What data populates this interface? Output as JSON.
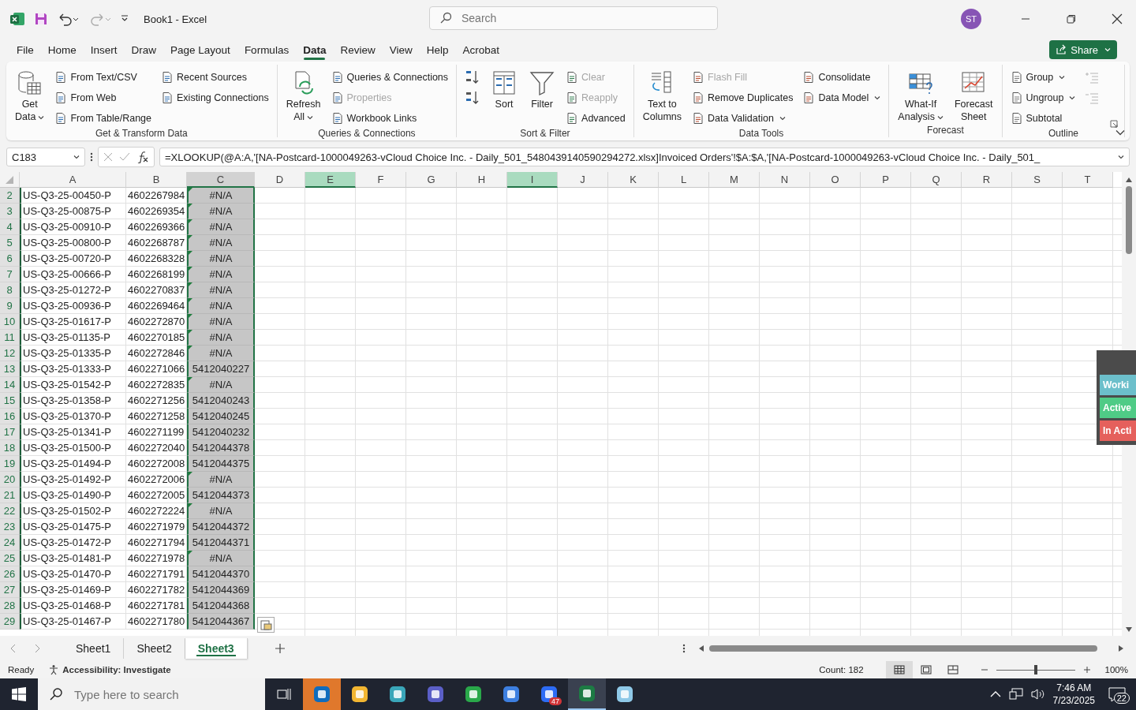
{
  "title_bar": {
    "title": "Book1  -  Excel",
    "search_placeholder": "Search",
    "avatar": "ST"
  },
  "menu_tabs": [
    {
      "label": "File",
      "selected": false
    },
    {
      "label": "Home",
      "selected": false
    },
    {
      "label": "Insert",
      "selected": false
    },
    {
      "label": "Draw",
      "selected": false
    },
    {
      "label": "Page Layout",
      "selected": false
    },
    {
      "label": "Formulas",
      "selected": false
    },
    {
      "label": "Data",
      "selected": true
    },
    {
      "label": "Review",
      "selected": false
    },
    {
      "label": "View",
      "selected": false
    },
    {
      "label": "Help",
      "selected": false
    },
    {
      "label": "Acrobat",
      "selected": false
    }
  ],
  "share_button": "Share",
  "ribbon_groups": [
    {
      "label": "Get & Transform Data",
      "items": [
        {
          "label": "Get\nData",
          "kind": "large",
          "dropdown": true,
          "disabled": false
        },
        {
          "label": "From Text/CSV",
          "kind": "small",
          "dropdown": false,
          "disabled": false
        },
        {
          "label": "From Web",
          "kind": "small",
          "dropdown": false,
          "disabled": false
        },
        {
          "label": "From Table/Range",
          "kind": "small",
          "dropdown": false,
          "disabled": false
        },
        {
          "label": "Recent Sources",
          "kind": "small",
          "dropdown": false,
          "disabled": false
        },
        {
          "label": "Existing Connections",
          "kind": "small",
          "dropdown": false,
          "disabled": false
        }
      ]
    },
    {
      "label": "Queries & Connections",
      "items": [
        {
          "label": "Refresh\nAll",
          "kind": "large",
          "dropdown": true,
          "disabled": false
        },
        {
          "label": "Queries & Connections",
          "kind": "small",
          "dropdown": false,
          "disabled": false
        },
        {
          "label": "Properties",
          "kind": "small",
          "dropdown": false,
          "disabled": true
        },
        {
          "label": "Workbook Links",
          "kind": "small",
          "dropdown": false,
          "disabled": false
        }
      ]
    },
    {
      "label": "Sort & Filter",
      "items": [
        {
          "kind": "icon",
          "disabled": false
        },
        {
          "kind": "icon",
          "disabled": false
        },
        {
          "label": "Sort",
          "kind": "large",
          "dropdown": false,
          "disabled": false
        },
        {
          "label": "Filter",
          "kind": "large",
          "dropdown": false,
          "disabled": false
        },
        {
          "label": "Clear",
          "kind": "small",
          "dropdown": false,
          "disabled": true
        },
        {
          "label": "Reapply",
          "kind": "small",
          "dropdown": false,
          "disabled": true
        },
        {
          "label": "Advanced",
          "kind": "small",
          "dropdown": false,
          "disabled": false
        }
      ]
    },
    {
      "label": "Data Tools",
      "items": [
        {
          "label": "Text to\nColumns",
          "kind": "large",
          "dropdown": false,
          "disabled": false
        },
        {
          "label": "Flash Fill",
          "kind": "small",
          "dropdown": false,
          "disabled": true
        },
        {
          "label": "Remove Duplicates",
          "kind": "small",
          "dropdown": false,
          "disabled": false
        },
        {
          "label": "Data Validation",
          "kind": "small",
          "dropdown": true,
          "disabled": false
        },
        {
          "label": "Consolidate",
          "kind": "small",
          "dropdown": false,
          "disabled": false
        },
        {
          "label": "Data Model",
          "kind": "small",
          "dropdown": true,
          "disabled": false
        }
      ]
    },
    {
      "label": "Forecast",
      "items": [
        {
          "label": "What-If\nAnalysis",
          "kind": "large",
          "dropdown": true,
          "disabled": false
        },
        {
          "label": "Forecast\nSheet",
          "kind": "large",
          "dropdown": false,
          "disabled": false
        }
      ]
    },
    {
      "label": "Outline",
      "items": [
        {
          "label": "Group",
          "kind": "small",
          "dropdown": true,
          "disabled": false
        },
        {
          "label": "Ungroup",
          "kind": "small",
          "dropdown": true,
          "disabled": false
        },
        {
          "label": "Subtotal",
          "kind": "small",
          "dropdown": false,
          "disabled": false
        },
        {
          "kind": "icon",
          "disabled": true
        },
        {
          "kind": "icon",
          "disabled": true
        }
      ]
    }
  ],
  "formula_bar": {
    "name_box": "C183",
    "formula": "=XLOOKUP(@A:A,'[NA-Postcard-1000049263-vCloud Choice Inc. - Daily_501_5480439140590294272.xlsx]Invoiced Orders'!$A:$A,'[NA-Postcard-1000049263-vCloud Choice Inc. - Daily_501_"
  },
  "columns": [
    {
      "label": "A",
      "in_range": false,
      "selected": false
    },
    {
      "label": "B",
      "in_range": false,
      "selected": false
    },
    {
      "label": "C",
      "in_range": true,
      "selected": false
    },
    {
      "label": "D",
      "in_range": false,
      "selected": false
    },
    {
      "label": "E",
      "in_range": false,
      "selected": true
    },
    {
      "label": "F",
      "in_range": false,
      "selected": false
    },
    {
      "label": "G",
      "in_range": false,
      "selected": false
    },
    {
      "label": "H",
      "in_range": false,
      "selected": false
    },
    {
      "label": "I",
      "in_range": false,
      "selected": true
    },
    {
      "label": "J",
      "in_range": false,
      "selected": false
    },
    {
      "label": "K",
      "in_range": false,
      "selected": false
    },
    {
      "label": "L",
      "in_range": false,
      "selected": false
    },
    {
      "label": "M",
      "in_range": false,
      "selected": false
    },
    {
      "label": "N",
      "in_range": false,
      "selected": false
    },
    {
      "label": "O",
      "in_range": false,
      "selected": false
    },
    {
      "label": "P",
      "in_range": false,
      "selected": false
    },
    {
      "label": "Q",
      "in_range": false,
      "selected": false
    },
    {
      "label": "R",
      "in_range": false,
      "selected": false
    },
    {
      "label": "S",
      "in_range": false,
      "selected": false
    },
    {
      "label": "T",
      "in_range": false,
      "selected": false
    }
  ],
  "rows": [
    {
      "number": "2",
      "selected": true,
      "flagged": true,
      "cells": [
        "US-Q3-25-00450-P",
        "4602267984",
        "#N/A"
      ]
    },
    {
      "number": "3",
      "selected": true,
      "flagged": true,
      "cells": [
        "US-Q3-25-00875-P",
        "4602269354",
        "#N/A"
      ]
    },
    {
      "number": "4",
      "selected": true,
      "flagged": true,
      "cells": [
        "US-Q3-25-00910-P",
        "4602269366",
        "#N/A"
      ]
    },
    {
      "number": "5",
      "selected": true,
      "flagged": true,
      "cells": [
        "US-Q3-25-00800-P",
        "4602268787",
        "#N/A"
      ]
    },
    {
      "number": "6",
      "selected": true,
      "flagged": true,
      "cells": [
        "US-Q3-25-00720-P",
        "4602268328",
        "#N/A"
      ]
    },
    {
      "number": "7",
      "selected": true,
      "flagged": true,
      "cells": [
        "US-Q3-25-00666-P",
        "4602268199",
        "#N/A"
      ]
    },
    {
      "number": "8",
      "selected": true,
      "flagged": true,
      "cells": [
        "US-Q3-25-01272-P",
        "4602270837",
        "#N/A"
      ]
    },
    {
      "number": "9",
      "selected": true,
      "flagged": true,
      "cells": [
        "US-Q3-25-00936-P",
        "4602269464",
        "#N/A"
      ]
    },
    {
      "number": "10",
      "selected": true,
      "flagged": true,
      "cells": [
        "US-Q3-25-01617-P",
        "4602272870",
        "#N/A"
      ]
    },
    {
      "number": "11",
      "selected": true,
      "flagged": true,
      "cells": [
        "US-Q3-25-01135-P",
        "4602270185",
        "#N/A"
      ]
    },
    {
      "number": "12",
      "selected": true,
      "flagged": true,
      "cells": [
        "US-Q3-25-01335-P",
        "4602272846",
        "#N/A"
      ]
    },
    {
      "number": "13",
      "selected": true,
      "flagged": false,
      "cells": [
        "US-Q3-25-01333-P",
        "4602271066",
        "5412040227"
      ]
    },
    {
      "number": "14",
      "selected": true,
      "flagged": true,
      "cells": [
        "US-Q3-25-01542-P",
        "4602272835",
        "#N/A"
      ]
    },
    {
      "number": "15",
      "selected": true,
      "flagged": false,
      "cells": [
        "US-Q3-25-01358-P",
        "4602271256",
        "5412040243"
      ]
    },
    {
      "number": "16",
      "selected": true,
      "flagged": false,
      "cells": [
        "US-Q3-25-01370-P",
        "4602271258",
        "5412040245"
      ]
    },
    {
      "number": "17",
      "selected": true,
      "flagged": false,
      "cells": [
        "US-Q3-25-01341-P",
        "4602271199",
        "5412040232"
      ]
    },
    {
      "number": "18",
      "selected": true,
      "flagged": false,
      "cells": [
        "US-Q3-25-01500-P",
        "4602272040",
        "5412044378"
      ]
    },
    {
      "number": "19",
      "selected": true,
      "flagged": false,
      "cells": [
        "US-Q3-25-01494-P",
        "4602272008",
        "5412044375"
      ]
    },
    {
      "number": "20",
      "selected": true,
      "flagged": true,
      "cells": [
        "US-Q3-25-01492-P",
        "4602272006",
        "#N/A"
      ]
    },
    {
      "number": "21",
      "selected": true,
      "flagged": false,
      "cells": [
        "US-Q3-25-01490-P",
        "4602272005",
        "5412044373"
      ]
    },
    {
      "number": "22",
      "selected": true,
      "flagged": true,
      "cells": [
        "US-Q3-25-01502-P",
        "4602272224",
        "#N/A"
      ]
    },
    {
      "number": "23",
      "selected": true,
      "flagged": false,
      "cells": [
        "US-Q3-25-01475-P",
        "4602271979",
        "5412044372"
      ]
    },
    {
      "number": "24",
      "selected": true,
      "flagged": false,
      "cells": [
        "US-Q3-25-01472-P",
        "4602271794",
        "5412044371"
      ]
    },
    {
      "number": "25",
      "selected": true,
      "flagged": true,
      "cells": [
        "US-Q3-25-01481-P",
        "4602271978",
        "#N/A"
      ]
    },
    {
      "number": "26",
      "selected": true,
      "flagged": false,
      "cells": [
        "US-Q3-25-01470-P",
        "4602271791",
        "5412044370"
      ]
    },
    {
      "number": "27",
      "selected": true,
      "flagged": false,
      "cells": [
        "US-Q3-25-01469-P",
        "4602271782",
        "5412044369"
      ]
    },
    {
      "number": "28",
      "selected": true,
      "flagged": false,
      "cells": [
        "US-Q3-25-01468-P",
        "4602271781",
        "5412044368"
      ]
    },
    {
      "number": "29",
      "selected": true,
      "flagged": false,
      "cells": [
        "US-Q3-25-01467-P",
        "4602271780",
        "5412044367"
      ]
    }
  ],
  "status_panel": [
    {
      "label": "Worki",
      "color": "#6cbfcb"
    },
    {
      "label": "Active",
      "color": "#4fcb86"
    },
    {
      "label": "In Acti",
      "color": "#e5605c"
    }
  ],
  "sheet_tabs": [
    {
      "label": "Sheet1",
      "selected": false
    },
    {
      "label": "Sheet2",
      "selected": false
    },
    {
      "label": "Sheet3",
      "selected": true
    }
  ],
  "status_bar": {
    "ready": "Ready",
    "accessibility": "Accessibility: Investigate",
    "count": "Count: 182",
    "views": [
      {
        "selected": true
      },
      {
        "selected": false
      },
      {
        "selected": false
      }
    ],
    "zoom_slider": {
      "level": 0.5
    },
    "zoom": "100%"
  },
  "taskbar": {
    "search_placeholder": "Type here to search",
    "apps": [
      {
        "color": "#0f6cbd",
        "selected": false,
        "attention": true
      },
      {
        "color": "#f2b632",
        "selected": false,
        "attention": false
      },
      {
        "color": "#3aa6b9",
        "selected": false,
        "attention": false
      },
      {
        "color": "#5b5fc7",
        "selected": false,
        "attention": false
      },
      {
        "color": "#2aa84a",
        "selected": false,
        "attention": false
      },
      {
        "color": "#3d7fe0",
        "selected": false,
        "attention": false
      },
      {
        "color": "#2d6cf5",
        "selected": false,
        "attention": false,
        "badge": "47"
      },
      {
        "color": "#1d7b44",
        "selected": true,
        "attention": false
      },
      {
        "color": "#8fc9e8",
        "selected": false,
        "attention": false
      }
    ],
    "time": "7:46 AM",
    "date": "7/23/2025",
    "notifications": "22"
  }
}
